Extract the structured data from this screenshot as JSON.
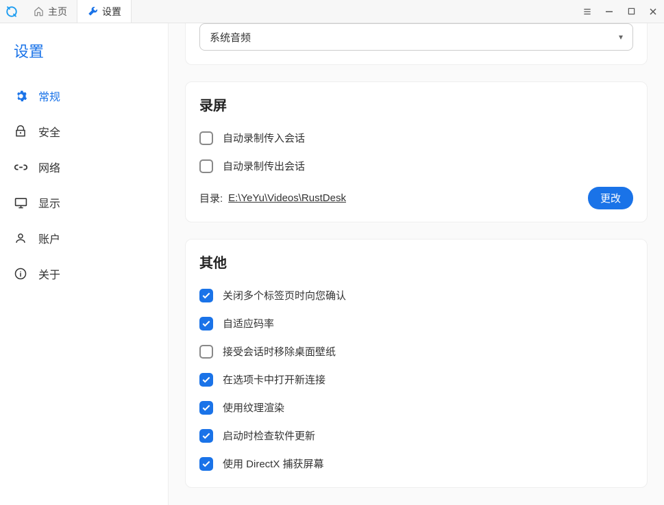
{
  "tabs": {
    "home": "主页",
    "settings": "设置"
  },
  "sidebar": {
    "title": "设置",
    "items": {
      "general": "常规",
      "security": "安全",
      "network": "网络",
      "display": "显示",
      "account": "账户",
      "about": "关于"
    }
  },
  "audio": {
    "selected": "系统音频"
  },
  "recording": {
    "title": "录屏",
    "auto_in": "自动录制传入会话",
    "auto_out": "自动录制传出会话",
    "dir_label": "目录:",
    "dir_path": "E:\\YeYu\\Videos\\RustDesk",
    "change_btn": "更改"
  },
  "other": {
    "title": "其他",
    "items": [
      {
        "label": "关闭多个标签页时向您确认",
        "checked": true
      },
      {
        "label": "自适应码率",
        "checked": true
      },
      {
        "label": "接受会话时移除桌面壁纸",
        "checked": false
      },
      {
        "label": "在选项卡中打开新连接",
        "checked": true
      },
      {
        "label": "使用纹理渲染",
        "checked": true
      },
      {
        "label": "启动时检查软件更新",
        "checked": true
      },
      {
        "label": "使用 DirectX 捕获屏幕",
        "checked": true
      }
    ]
  }
}
